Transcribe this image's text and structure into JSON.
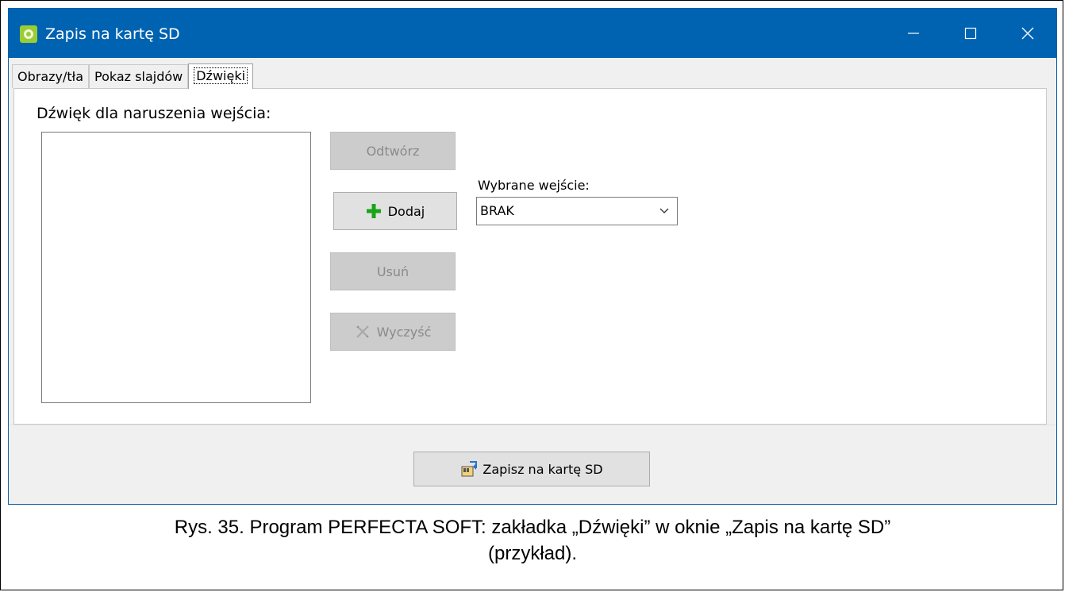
{
  "window": {
    "title": "Zapis na kartę SD"
  },
  "tabs": [
    {
      "label": "Obrazy/tła",
      "active": false
    },
    {
      "label": "Pokaz slajdów",
      "active": false
    },
    {
      "label": "Dźwięki",
      "active": true
    }
  ],
  "panel": {
    "sound_label": "Dźwięk dla naruszenia wejścia:",
    "buttons": {
      "play": "Odtwórz",
      "add": "Dodaj",
      "remove": "Usuń",
      "clear": "Wyczyść"
    },
    "input_select": {
      "label": "Wybrane wejście:",
      "value": "BRAK"
    }
  },
  "footer": {
    "save_label": "Zapisz na kartę SD"
  },
  "caption": {
    "line1": "Rys. 35. Program PERFECTA SOFT: zakładka „Dźwięki” w oknie „Zapis na kartę SD”",
    "line2": "(przykład)."
  },
  "colors": {
    "titlebar": "#0063b1",
    "add_icon": "#1aa31a",
    "app_icon": "#9acd32"
  },
  "icons": [
    "app-logo-icon",
    "minimize-icon",
    "maximize-icon",
    "close-icon",
    "plus-icon",
    "eraser-icon",
    "chevron-down-icon",
    "sd-card-save-icon"
  ]
}
